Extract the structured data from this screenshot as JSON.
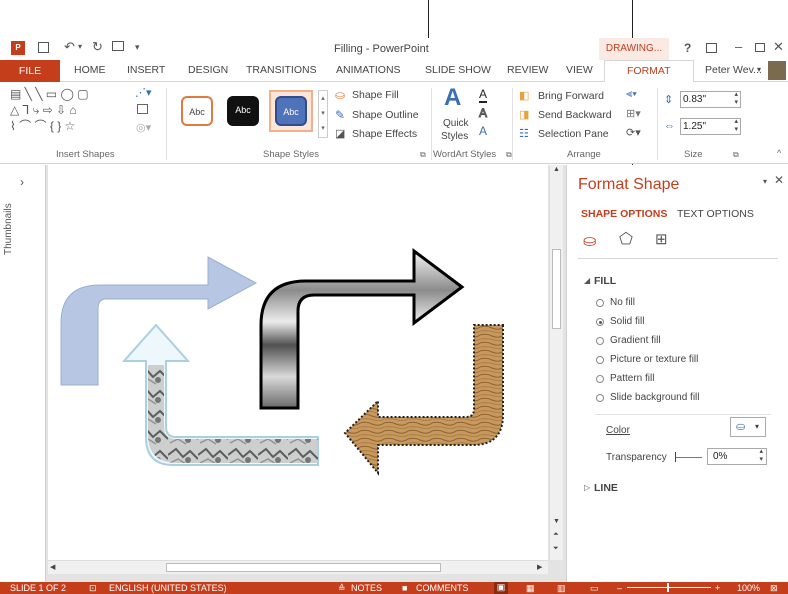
{
  "window": {
    "title": "Filling - PowerPoint",
    "help": "?",
    "user": "Peter Wev...",
    "contextual_tab": "DRAWING..."
  },
  "tabs": [
    {
      "label": "FILE"
    },
    {
      "label": "HOME"
    },
    {
      "label": "INSERT"
    },
    {
      "label": "DESIGN"
    },
    {
      "label": "TRANSITIONS"
    },
    {
      "label": "ANIMATIONS"
    },
    {
      "label": "SLIDE SHOW"
    },
    {
      "label": "REVIEW"
    },
    {
      "label": "VIEW"
    },
    {
      "label": "FORMAT"
    }
  ],
  "ribbon": {
    "insert_shapes_label": "Insert Shapes",
    "shape_styles_label": "Shape Styles",
    "style_abc": "Abc",
    "shape_fill": "Shape Fill",
    "shape_outline": "Shape Outline",
    "shape_effects": "Shape Effects",
    "quick_styles_line1": "Quick",
    "quick_styles_line2": "Styles",
    "wordart_label": "WordArt Styles",
    "bring_forward": "Bring Forward",
    "send_backward": "Send Backward",
    "selection_pane": "Selection Pane",
    "arrange_label": "Arrange",
    "height_value": "0.83\"",
    "width_value": "1.25\"",
    "size_label": "Size"
  },
  "thumbnails_label": "Thumbnails",
  "format_pane": {
    "title": "Format Shape",
    "tab_shape": "SHAPE OPTIONS",
    "tab_text": "TEXT OPTIONS",
    "fill_header": "FILL",
    "options": [
      {
        "label": "No fill",
        "selected": false
      },
      {
        "label": "Solid fill",
        "selected": true
      },
      {
        "label": "Gradient fill",
        "selected": false
      },
      {
        "label": "Picture or texture fill",
        "selected": false
      },
      {
        "label": "Pattern fill",
        "selected": false
      },
      {
        "label": "Slide background fill",
        "selected": false
      }
    ],
    "color_label": "Color",
    "transparency_label": "Transparency",
    "transparency_value": "0%",
    "line_header": "LINE"
  },
  "status": {
    "slide": "SLIDE 1 OF 2",
    "language": "ENGLISH (UNITED STATES)",
    "notes": "NOTES",
    "comments": "COMMENTS",
    "zoom": "100%"
  },
  "colors": {
    "accent": "#c43e1c",
    "format_tab": "#c43e1c",
    "pane_title": "#c43e1c"
  }
}
